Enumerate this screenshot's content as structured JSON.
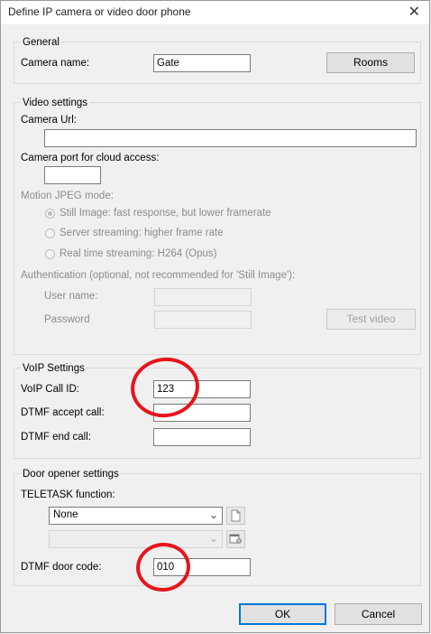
{
  "window": {
    "title": "Define IP camera or video door phone",
    "close_glyph": "✕"
  },
  "general": {
    "legend": "General",
    "camera_name_label": "Camera name:",
    "camera_name_value": "Gate",
    "rooms_button": "Rooms"
  },
  "video": {
    "legend": "Video settings",
    "camera_url_label": "Camera Url:",
    "camera_url_value": "",
    "cloud_port_label": "Camera port for cloud access:",
    "cloud_port_value": "",
    "mjpeg_label": "Motion JPEG mode:",
    "modes": [
      {
        "label": "Still Image: fast response, but lower framerate",
        "checked": true
      },
      {
        "label": "Server streaming: higher frame rate",
        "checked": false
      },
      {
        "label": "Real time streaming: H264 (Opus)",
        "checked": false
      }
    ],
    "auth_label": "Authentication (optional, not recommended for 'Still Image'):",
    "username_label": "User name:",
    "password_label": "Password",
    "test_video_button": "Test video"
  },
  "voip": {
    "legend": "VoIP Settings",
    "call_id_label": "VoIP Call ID:",
    "call_id_value": "123",
    "accept_label": "DTMF accept call:",
    "accept_value": "",
    "end_label": "DTMF end call:",
    "end_value": ""
  },
  "door": {
    "legend": "Door opener settings",
    "function_label": "TELETASK function:",
    "function_value": "None",
    "second_value": "",
    "door_code_label": "DTMF door code:",
    "door_code_value": "010"
  },
  "footer": {
    "ok_button": "OK",
    "cancel_button": "Cancel"
  },
  "colors": {
    "annotation_red": "#e8141b",
    "default_button_border": "#0078d7"
  },
  "icons": {
    "new_document": "new-document-icon",
    "properties": "properties-icon"
  }
}
